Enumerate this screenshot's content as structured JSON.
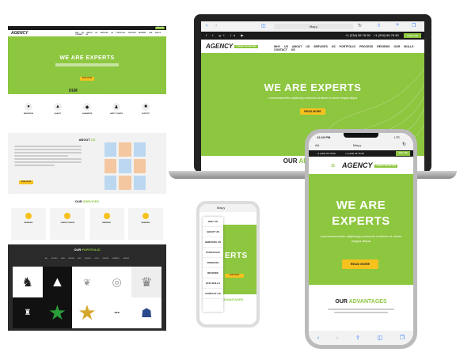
{
  "brand": {
    "logo": "AGENCY",
    "tagline": "COMPANY TAGLINE HERE"
  },
  "colors": {
    "accent": "#8dc63f",
    "yellow": "#f7c11e",
    "dark": "#1a1a1a"
  },
  "contact": {
    "phone1": "+1 (234) 56 78 90",
    "phone2": "+1 (234) 56 78 90",
    "call_btn": "CALL US"
  },
  "nav": [
    "WHY US",
    "ABOUT US",
    "SERVICES US",
    "PORTFOLIO",
    "PROCESS",
    "REVIEWS",
    "OUR SKILLS",
    "CONTACT US"
  ],
  "hero": {
    "title": "WE ARE EXPERTS",
    "title_line1": "WE ARE",
    "title_line2": "EXPERTS",
    "body": "Loremconsectetur adipiscing commodo ut labore et dolore magna aliqua",
    "button": "READ MORE"
  },
  "advantages": {
    "title_a": "OUR ",
    "title_b": "ADVANTAGES",
    "items": [
      "INNOVATION",
      "QUALITY",
      "GUARANTEE",
      "HAPPY CLIENTS",
      "SUPPORT"
    ]
  },
  "about": {
    "title_a": "ABOUT ",
    "title_b": "US",
    "button": "READ MORE"
  },
  "services": {
    "title_a": "OUR ",
    "title_b": "SERVICES",
    "items": [
      "BRANDING",
      "GRAPHIC DESIGN",
      "BRANDING",
      "BRANDING"
    ]
  },
  "portfolio": {
    "title_a": "OUR ",
    "title_b": "PORTFOLIO",
    "filters": [
      "ALL WORKS",
      "WEB DESIGN",
      "APP DESIGN",
      "LOGO DESIGN",
      "GRAPHIC DESIGN"
    ]
  },
  "browser": {
    "tab": "AA",
    "url": "Мау.у"
  },
  "phone": {
    "time": "12:10 PM",
    "signal": "LTE",
    "tab": "AA",
    "url": "Мау.у"
  },
  "small_phone_menu": [
    "WHY US",
    "ABOUT US",
    "SERVICES US",
    "PORTFOLIO",
    "PROCESS",
    "REVIEWS",
    "OUR SKILLS",
    "CONTACT US"
  ],
  "small_phone": {
    "hero_text": "ERTS",
    "advantages_label": "ADVANTAGES"
  }
}
